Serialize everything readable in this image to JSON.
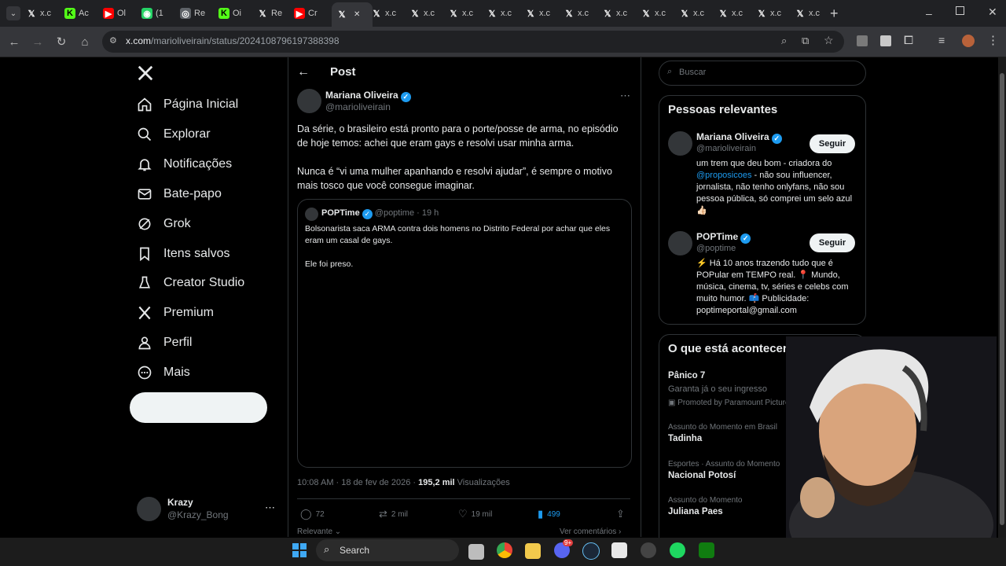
{
  "browser": {
    "tabs": [
      {
        "icon": "x-icon",
        "label": "x.c",
        "color": "#000000"
      },
      {
        "icon": "kick-icon",
        "label": "Ac",
        "color": "#53fc18"
      },
      {
        "icon": "youtube-icon",
        "label": "Ol",
        "color": "#ff0000"
      },
      {
        "icon": "whatsapp-icon",
        "label": "(1",
        "color": "#25d366"
      },
      {
        "icon": "generic-icon",
        "label": "Re",
        "color": "#5f6368"
      },
      {
        "icon": "kick-icon",
        "label": "Oi",
        "color": "#53fc18"
      },
      {
        "icon": "x-icon",
        "label": "Re",
        "color": "#000000"
      },
      {
        "icon": "youtube-icon",
        "label": "Cr",
        "color": "#ff0000"
      },
      {
        "icon": "x-icon",
        "label": "",
        "color": "#000000",
        "active": true
      },
      {
        "icon": "x-icon",
        "label": "x.c",
        "color": "#000000"
      },
      {
        "icon": "x-icon",
        "label": "x.c",
        "color": "#000000"
      },
      {
        "icon": "x-icon",
        "label": "x.c",
        "color": "#000000"
      },
      {
        "icon": "x-icon",
        "label": "x.c",
        "color": "#000000"
      },
      {
        "icon": "x-icon",
        "label": "x.c",
        "color": "#000000"
      },
      {
        "icon": "x-icon",
        "label": "x.c",
        "color": "#000000"
      },
      {
        "icon": "x-icon",
        "label": "x.c",
        "color": "#000000"
      },
      {
        "icon": "x-icon",
        "label": "x.c",
        "color": "#000000"
      },
      {
        "icon": "x-icon",
        "label": "x.c",
        "color": "#000000"
      },
      {
        "icon": "x-icon",
        "label": "x.c",
        "color": "#000000"
      },
      {
        "icon": "x-icon",
        "label": "x.c",
        "color": "#000000"
      },
      {
        "icon": "x-icon",
        "label": "x.c",
        "color": "#000000"
      }
    ],
    "url_domain": "x.com",
    "url_path": "/marioliveirain/status/2024108796197388398"
  },
  "sidebar": {
    "items": [
      {
        "label": "Página Inicial",
        "icon": "home-icon"
      },
      {
        "label": "Explorar",
        "icon": "search-icon"
      },
      {
        "label": "Notificações",
        "icon": "bell-icon"
      },
      {
        "label": "Bate-papo",
        "icon": "mail-icon"
      },
      {
        "label": "Grok",
        "icon": "grok-icon"
      },
      {
        "label": "Itens salvos",
        "icon": "bookmark-icon"
      },
      {
        "label": "Creator Studio",
        "icon": "creator-icon"
      },
      {
        "label": "Premium",
        "icon": "x-icon"
      },
      {
        "label": "Perfil",
        "icon": "person-icon"
      },
      {
        "label": "Mais",
        "icon": "more-icon"
      }
    ],
    "account": {
      "name": "Krazy",
      "handle": "@Krazy_Bong"
    }
  },
  "post": {
    "header": "Post",
    "author_name": "Mariana Oliveira",
    "author_handle": "@marioliveirain",
    "text_p1": "Da série, o brasileiro está pronto para o porte/posse de arma, no episódio de hoje temos: achei que eram gays e resolvi usar minha arma.",
    "text_p2": "Nunca é “vi uma mulher apanhando e resolvi ajudar”, é sempre o motivo mais tosco que você consegue imaginar.",
    "quote": {
      "name": "POPTime",
      "handle": "@poptime · 19 h",
      "text_p1": "Bolsonarista saca ARMA contra dois homens no Distrito Federal por achar que eles eram um casal de gays.",
      "text_p2": "Ele foi preso."
    },
    "timestamp": "10:08 AM · 18 de fev de 2026 · ",
    "views_count": "195,2 mil",
    "views_label": " Visualizações",
    "replies": "72",
    "reposts": "2 mil",
    "likes": "19 mil",
    "bookmarks": "499",
    "sort_label": "Relevante",
    "view_comments": "Ver comentários"
  },
  "right": {
    "search_placeholder": "Buscar",
    "relevant_title": "Pessoas relevantes",
    "people": [
      {
        "name": "Mariana Oliveira",
        "handle": "@marioliveirain",
        "follow": "Seguir",
        "bio_pre": "um trem que deu bom - criadora do ",
        "bio_link": "@proposicoes",
        "bio_post": " - não sou influencer, jornalista, não tenho onlyfans, não sou pessoa pública, só comprei um selo azul 👍🏻"
      },
      {
        "name": "POPTime",
        "handle": "@poptime",
        "follow": "Seguir",
        "bio": "⚡ Há 10 anos trazendo tudo que é POPular em TEMPO real. 📍 Mundo, música, cinema, tv, séries e celebs com muito humor. 📫 Publicidade: poptimeportal@gmail.com"
      }
    ],
    "happening_title": "O que está acontecendo",
    "trends": [
      {
        "name": "Pânico 7",
        "sub": "Garanta já o seu ingresso",
        "promo": "Promoted by Paramount Pictures"
      },
      {
        "meta": "Assunto do Momento em Brasil",
        "name": "Tadinha"
      },
      {
        "meta": "Esportes · Assunto do Momento",
        "name": "Nacional Potosí"
      },
      {
        "meta": "Assunto do Momento",
        "name": "Juliana Paes"
      }
    ]
  },
  "taskbar": {
    "search_label": "Search",
    "discord_badge": "9+"
  }
}
